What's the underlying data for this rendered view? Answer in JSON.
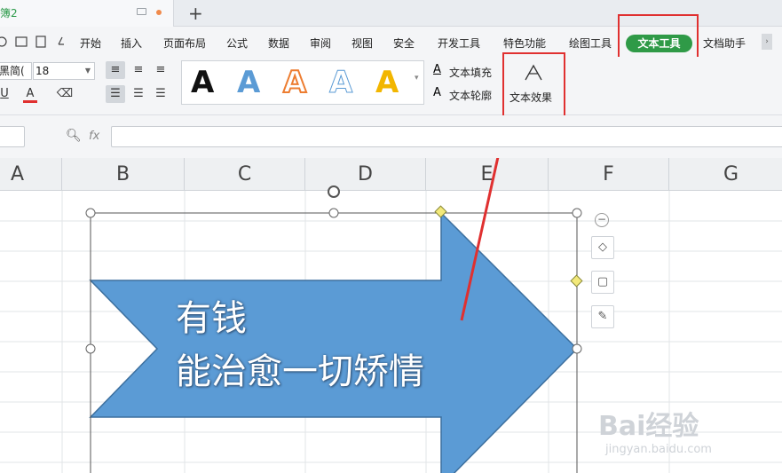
{
  "tab": {
    "title": "簿2"
  },
  "menu": [
    "开始",
    "插入",
    "页面布局",
    "公式",
    "数据",
    "审阅",
    "视图",
    "安全",
    "开发工具",
    "特色功能",
    "绘图工具",
    "文本工具",
    "文档助手"
  ],
  "ribbon": {
    "font_name": "黑简(",
    "font_size": "18",
    "text_fill": "文本填充",
    "text_outline": "文本轮廓",
    "text_effect": "文本效果",
    "gallery_letters": [
      "A",
      "A",
      "A",
      "A",
      "A"
    ]
  },
  "formula": {
    "fx": "fx"
  },
  "columns": [
    "A",
    "B",
    "C",
    "D",
    "E",
    "F",
    "G"
  ],
  "shape": {
    "line1": "有钱",
    "line2": "能治愈一切矫情"
  },
  "watermark": {
    "brand": "Bai经验",
    "url": "jingyan.baidu.com"
  },
  "colors": {
    "accent_green": "#2f9a47",
    "arrow_fill": "#5b9bd5",
    "highlight": "#e03030"
  }
}
